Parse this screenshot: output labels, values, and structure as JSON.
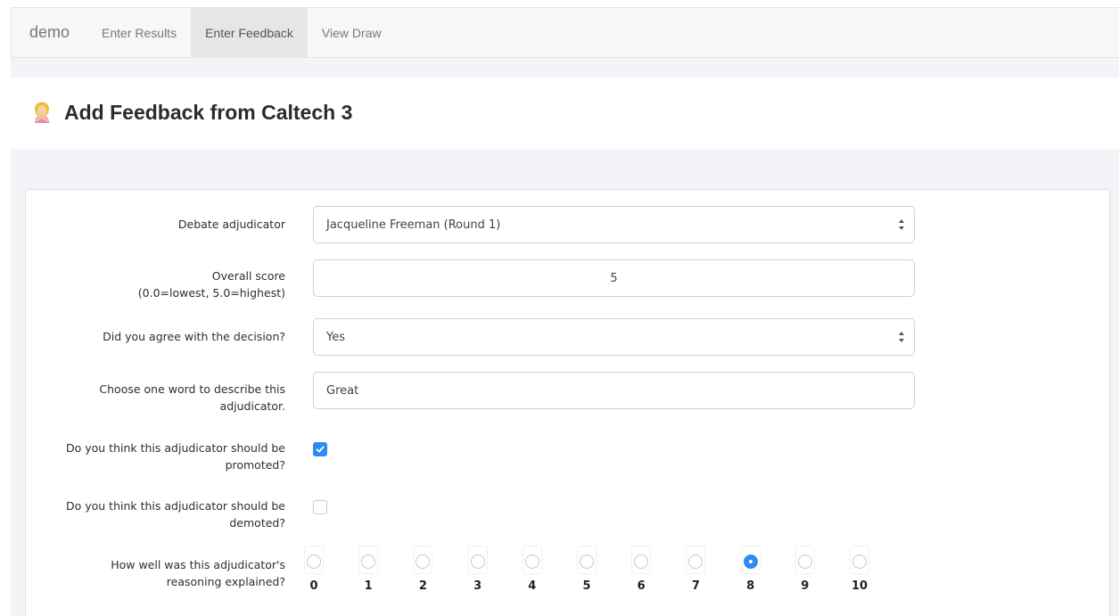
{
  "nav": {
    "brand": "demo",
    "items": [
      {
        "label": "Enter Results",
        "active": false
      },
      {
        "label": "Enter Feedback",
        "active": true
      },
      {
        "label": "View Draw",
        "active": false
      }
    ]
  },
  "page": {
    "title": "Add Feedback from Caltech 3",
    "icon": "woman-gesturing-no-icon"
  },
  "form": {
    "adjudicator": {
      "label": "Debate adjudicator",
      "value": "Jacqueline Freeman (Round 1)"
    },
    "overall_score": {
      "label_line1": "Overall score",
      "label_line2": "(0.0=lowest, 5.0=highest)",
      "value": "5"
    },
    "agree": {
      "label": "Did you agree with the decision?",
      "value": "Yes"
    },
    "one_word": {
      "label_line1": "Choose one word to describe this",
      "label_line2": "adjudicator.",
      "value": "Great"
    },
    "promoted": {
      "label_line1": "Do you think this adjudicator should be",
      "label_line2": "promoted?",
      "checked": true
    },
    "demoted": {
      "label_line1": "Do you think this adjudicator should be",
      "label_line2": "demoted?",
      "checked": false
    },
    "reasoning": {
      "label_line1": "How well was this adjudicator's",
      "label_line2": "reasoning explained?",
      "options": [
        "0",
        "1",
        "2",
        "3",
        "4",
        "5",
        "6",
        "7",
        "8",
        "9",
        "10"
      ],
      "selected": "8"
    }
  },
  "colors": {
    "accent": "#2d8cf0",
    "nav_bg": "#f7f7f7",
    "band_bg": "#f2f4f7"
  }
}
